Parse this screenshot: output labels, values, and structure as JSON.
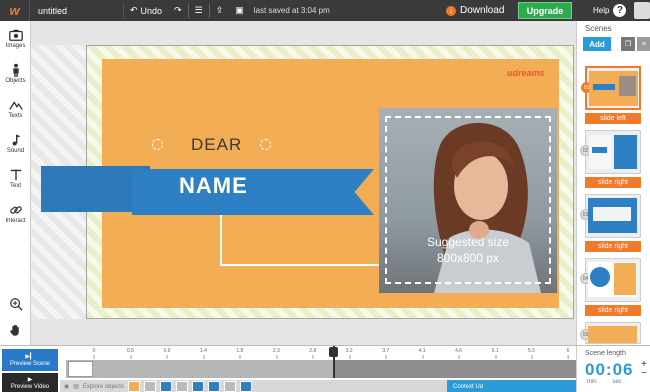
{
  "topbar": {
    "logo": "w",
    "title_value": "untitled",
    "undo_label": "Undo",
    "saved_text": "last saved at 3:04 pm",
    "download_label": "Download",
    "upgrade_label": "Upgrade",
    "help_label": "Help",
    "help_glyph": "?"
  },
  "tools": [
    {
      "label": "Images",
      "icon": "camera-icon"
    },
    {
      "label": "Objects",
      "icon": "person-icon"
    },
    {
      "label": "Texts",
      "icon": "mountain-icon"
    },
    {
      "label": "Sound",
      "icon": "music-note-icon"
    },
    {
      "label": "Text",
      "icon": "text-t-icon"
    },
    {
      "label": "Interact",
      "icon": "link-icon"
    }
  ],
  "canvas": {
    "dear": "DEAR",
    "name": "NAME",
    "suggested_line1": "Suggested size",
    "suggested_line2": "800x800 px",
    "brand": "udreams"
  },
  "scenes": {
    "title": "Scenes",
    "add_label": "Add",
    "items": [
      {
        "num": "01",
        "transition": "slide left",
        "active": true
      },
      {
        "num": "02",
        "transition": "slide right",
        "active": false
      },
      {
        "num": "03",
        "transition": "slide right",
        "active": false
      },
      {
        "num": "04",
        "transition": "slide right",
        "active": false
      },
      {
        "num": "05",
        "transition": "",
        "active": false
      }
    ]
  },
  "timeline": {
    "preview_scene": "Preview Scene",
    "preview_video": "Preview Video",
    "ticks": [
      "0",
      "0.5",
      "0.9",
      "1.4",
      "1.8",
      "2.3",
      "2.8",
      "3.2",
      "3.7",
      "4.1",
      "4.6",
      "5.1",
      "5.5",
      "6"
    ],
    "explore_label": "Explore objects",
    "context_label": "Context Ud",
    "scene_length_label": "Scene length",
    "scene_length_value": "00:06",
    "min_label": "min",
    "sec_label": "sec"
  },
  "colors": {
    "accent": "#f07a2a",
    "card": "#f3ae55",
    "ribbon": "#2c80c3",
    "upgrade": "#2eaa4e"
  }
}
